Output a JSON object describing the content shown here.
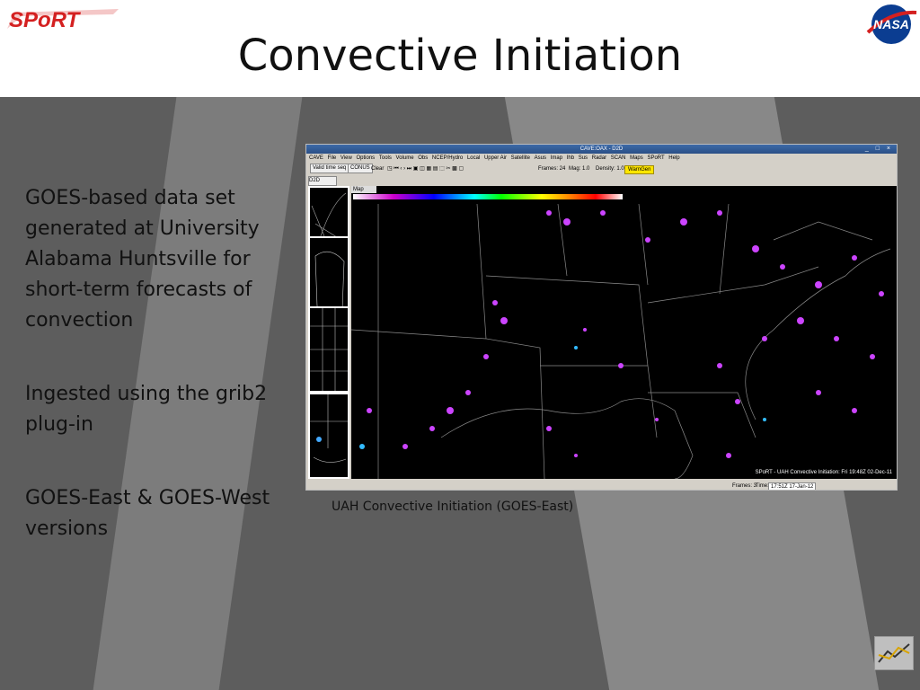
{
  "header": {
    "title": "Convective Initiation",
    "sport_logo_text": "SPoRT",
    "nasa_logo_text": "NASA"
  },
  "bullets": [
    "GOES-based data set generated at University Alabama Huntsville for short-term forecasts of convection",
    "Ingested using the grib2 plug-in",
    "GOES-East & GOES-West versions"
  ],
  "screenshot": {
    "window_title": "CAVE:OAX - D2D",
    "window_controls": "_ □ ×",
    "menu": [
      "CAVE",
      "File",
      "View",
      "Options",
      "Tools",
      "Volume",
      "Obs",
      "NCEP/Hydro",
      "Local",
      "Upper Air",
      "Satellite",
      "Asus",
      "Imap",
      "Ihb",
      "Sus",
      "Radar",
      "SCAN",
      "Maps",
      "SPoRT",
      "Help"
    ],
    "toolbar": {
      "valid_time": "Valid time seq",
      "conus": "CONUS",
      "clear": "Clear",
      "frames": "Frames: 24",
      "mag": "Mag: 1.0",
      "density": "Density: 1.0",
      "warngen": "WarnGen"
    },
    "d2d_tab": "D2D",
    "map_tab": "Map",
    "map_caption": "SPoRT - UAH Convective Initiation: Fri 19:48Z 02-Dec-11",
    "status": {
      "frames": "Frames: 3",
      "time_label": "Time:",
      "time_value": "17:51Z 17-Jan-12"
    }
  },
  "caption": "UAH Convective Initiation (GOES-East)",
  "colors": {
    "background": "#5d5d5d",
    "accent_purple": "#cc44ff",
    "sport_red": "#d42020",
    "nasa_blue": "#0b3d91"
  }
}
